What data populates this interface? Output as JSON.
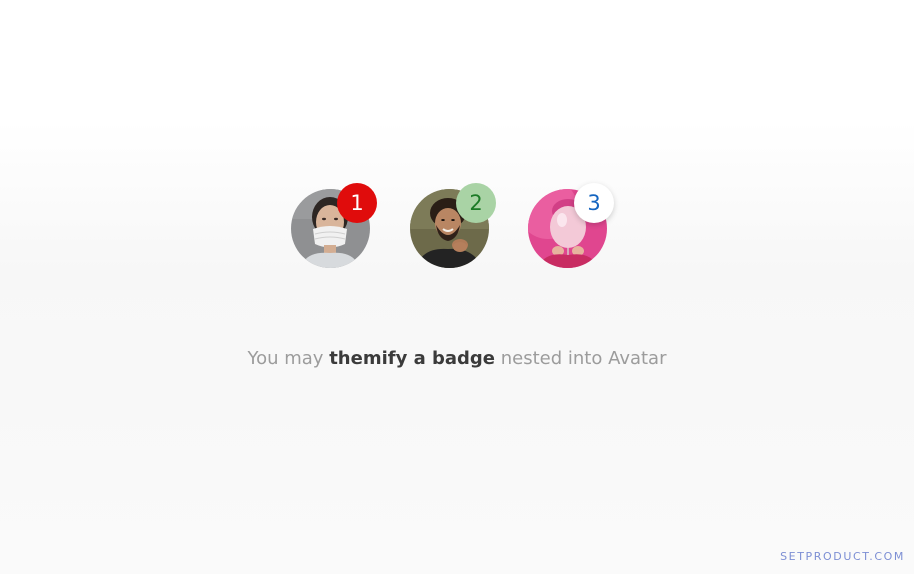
{
  "avatars": [
    {
      "badge": "1",
      "badge_bg": "#e00c0c",
      "badge_color": "#ffffff",
      "badge_variant": "filled",
      "photo": "woman-with-face-mask"
    },
    {
      "badge": "2",
      "badge_bg": "#a9d3a5",
      "badge_color": "#1b7a26",
      "badge_variant": "tonal",
      "photo": "smiling-man-with-beard"
    },
    {
      "badge": "3",
      "badge_bg": "#ffffff",
      "badge_color": "#1565c0",
      "badge_variant": "outlined",
      "photo": "woman-with-balloon"
    }
  ],
  "caption": {
    "lead": "You may ",
    "emphasis": "themify a badge",
    "tail": " nested into Avatar"
  },
  "brand": {
    "text": "SETPRODUCT.COM",
    "color": "#7d8fd4"
  }
}
